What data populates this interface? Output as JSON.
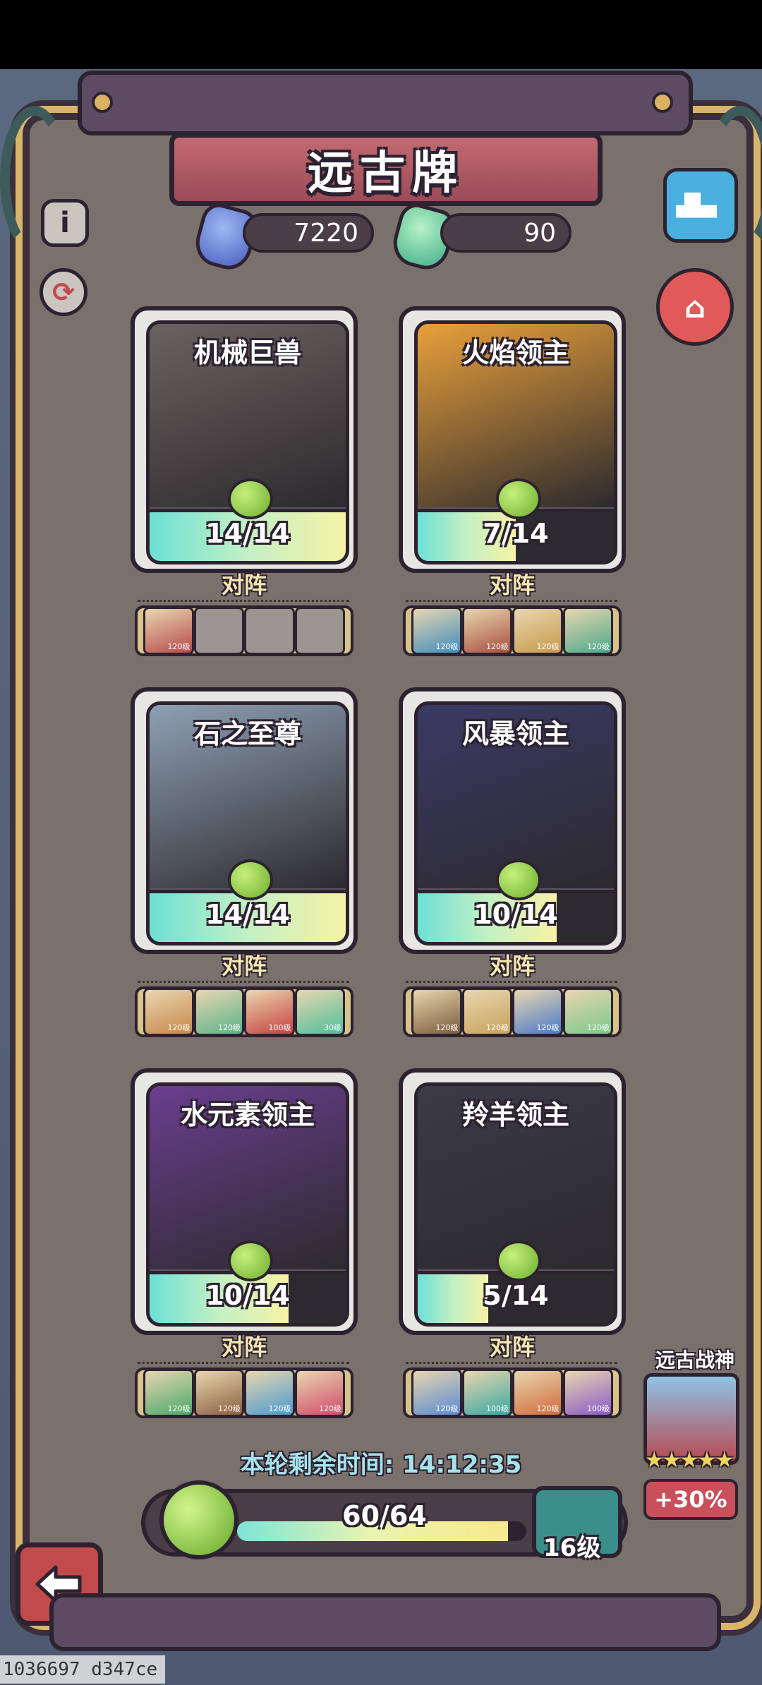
{
  "title": "远古牌",
  "currencies": [
    {
      "icon": "blue-crystal-icon",
      "value": "7220"
    },
    {
      "icon": "green-crystal-icon",
      "value": "90"
    }
  ],
  "cards": [
    {
      "name": "机械巨兽",
      "count": "14/14",
      "progress": 1.0,
      "vs_label": "对阵",
      "art_color": "#6a6260",
      "team": [
        {
          "level": "120级",
          "color": "#b84a4a"
        },
        {
          "level": "",
          "color": ""
        },
        {
          "level": "",
          "color": ""
        },
        {
          "level": "",
          "color": ""
        }
      ]
    },
    {
      "name": "火焰领主",
      "count": "7/14",
      "progress": 0.5,
      "vs_label": "对阵",
      "art_color": "#e9a03a",
      "team": [
        {
          "level": "120级",
          "color": "#3f8dbe"
        },
        {
          "level": "120级",
          "color": "#a84d3d"
        },
        {
          "level": "120级",
          "color": "#c69a4a"
        },
        {
          "level": "120级",
          "color": "#4aa88a"
        }
      ]
    },
    {
      "name": "石之至尊",
      "count": "14/14",
      "progress": 1.0,
      "vs_label": "对阵",
      "art_color": "#8ea0b4",
      "team": [
        {
          "level": "120级",
          "color": "#c8874a"
        },
        {
          "level": "120级",
          "color": "#5ab38a"
        },
        {
          "level": "100级",
          "color": "#c64040"
        },
        {
          "level": "30级",
          "color": "#4ebf9a"
        }
      ]
    },
    {
      "name": "风暴领主",
      "count": "10/14",
      "progress": 0.71,
      "vs_label": "对阵",
      "art_color": "#3b3a66",
      "team": [
        {
          "level": "120级",
          "color": "#7a5a3a"
        },
        {
          "level": "120级",
          "color": "#c7a25a"
        },
        {
          "level": "120级",
          "color": "#4a7ac8"
        },
        {
          "level": "120级",
          "color": "#7ac88a"
        }
      ]
    },
    {
      "name": "水元素领主",
      "count": "10/14",
      "progress": 0.71,
      "vs_label": "对阵",
      "art_color": "#6a3e8e",
      "team": [
        {
          "level": "120级",
          "color": "#4aa86a"
        },
        {
          "level": "120级",
          "color": "#8a5e3e"
        },
        {
          "level": "120级",
          "color": "#4a9ad0"
        },
        {
          "level": "120级",
          "color": "#d04a6a"
        }
      ]
    },
    {
      "name": "羚羊领主",
      "count": "5/14",
      "progress": 0.36,
      "vs_label": "对阵",
      "art_color": "#3c3a48",
      "team": [
        {
          "level": "120级",
          "color": "#5a8ad0"
        },
        {
          "level": "100级",
          "color": "#3aa8a0"
        },
        {
          "level": "120级",
          "color": "#d06a3a"
        },
        {
          "level": "100级",
          "color": "#8a5ac8"
        }
      ]
    }
  ],
  "timer_text": "本轮剩余时间: 14:12:35",
  "bean_progress": {
    "label": "60/64",
    "value": 60,
    "max": 64
  },
  "chest_level": "16级",
  "ancient_god": {
    "title": "远古战神",
    "stars": "★★★★★",
    "bonus": "+30%"
  },
  "build_id": "1036697 d347ce"
}
